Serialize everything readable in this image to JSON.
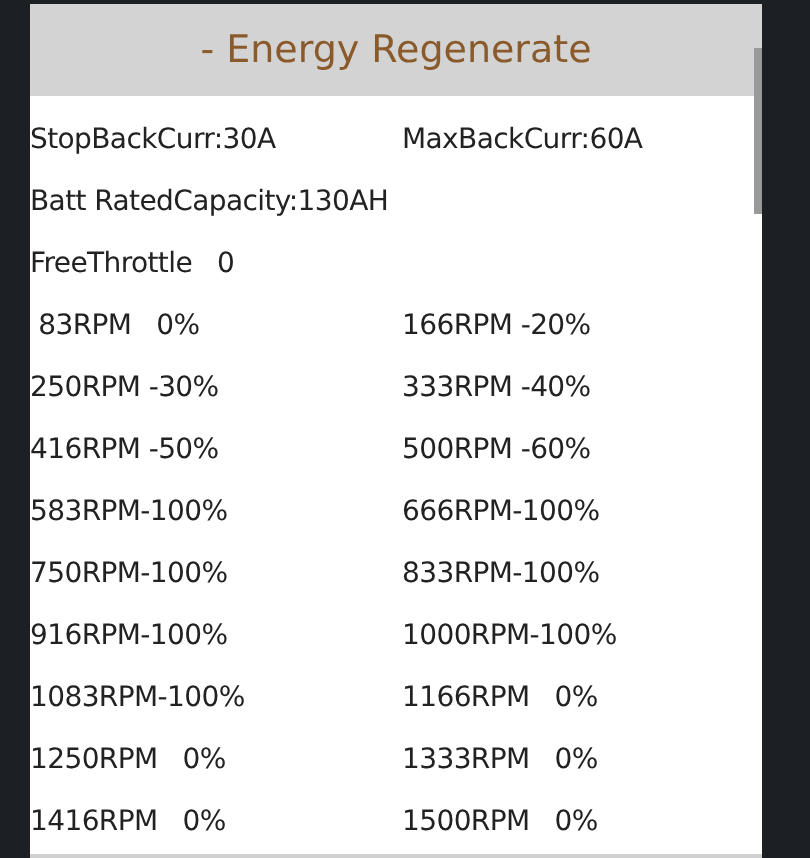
{
  "header": {
    "title": "- Energy Regenerate"
  },
  "rows": [
    {
      "cells": [
        "StopBackCurr:30A",
        "MaxBackCurr:60A"
      ]
    },
    {
      "cells": [
        "Batt RatedCapacity:130AH"
      ]
    },
    {
      "cells": [
        "FreeThrottle   0"
      ]
    },
    {
      "cells": [
        " 83RPM   0%",
        "166RPM -20%"
      ]
    },
    {
      "cells": [
        "250RPM -30%",
        "333RPM -40%"
      ]
    },
    {
      "cells": [
        "416RPM -50%",
        "500RPM -60%"
      ]
    },
    {
      "cells": [
        "583RPM-100%",
        "666RPM-100%"
      ]
    },
    {
      "cells": [
        "750RPM-100%",
        "833RPM-100%"
      ]
    },
    {
      "cells": [
        "916RPM-100%",
        "1000RPM-100%"
      ]
    },
    {
      "cells": [
        "1083RPM-100%",
        "1166RPM   0%"
      ]
    },
    {
      "cells": [
        "1250RPM   0%",
        "1333RPM   0%"
      ]
    },
    {
      "cells": [
        "1416RPM   0%",
        "1500RPM   0%"
      ]
    }
  ]
}
